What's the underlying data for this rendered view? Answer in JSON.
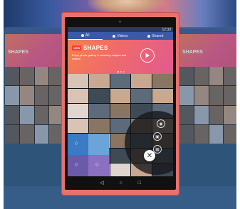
{
  "side_screen": {
    "label": "SHAPES"
  },
  "tablet": {
    "status": {
      "time": "12:30"
    },
    "tabs": [
      {
        "label": "All"
      },
      {
        "label": "Videos"
      },
      {
        "label": "Shared"
      }
    ],
    "hero": {
      "badge": "NEW",
      "title": "SHAPES",
      "subtitle": "Enjoy photo gallery in amazing shapes and motion",
      "play_icon": "play-icon"
    },
    "fab_menu": {
      "icons": [
        "camera-icon",
        "video-icon",
        "collage-icon"
      ],
      "close_icon": "close-icon",
      "close_glyph": "✕"
    },
    "nav": {
      "back_icon": "back-icon",
      "home_icon": "home-icon",
      "recent_icon": "recent-apps-icon",
      "back": "◁",
      "home": "○",
      "recent": "□"
    }
  },
  "colors": {
    "tablet_case": "#e9716d",
    "tab_bar": "#3a5aa8",
    "hero_gradient_start": "#f4824e",
    "hero_gradient_end": "#e25a8f",
    "background": "#2f4f72"
  }
}
